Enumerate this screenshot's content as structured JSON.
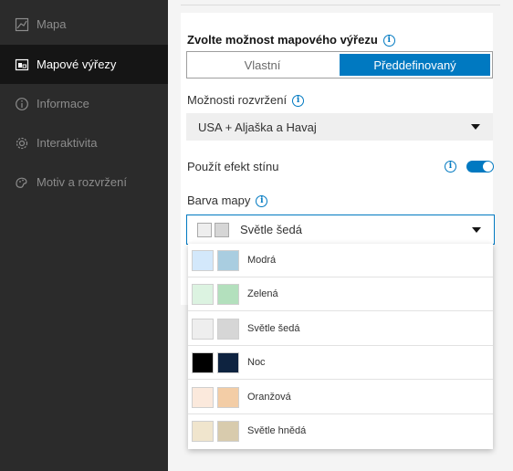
{
  "sidebar": {
    "items": [
      {
        "label": "Mapa",
        "icon": "map-icon"
      },
      {
        "label": "Mapové výřezy",
        "icon": "map-extent-icon"
      },
      {
        "label": "Informace",
        "icon": "info-icon"
      },
      {
        "label": "Interaktivita",
        "icon": "gear-icon"
      },
      {
        "label": "Motiv a rozvržení",
        "icon": "palette-icon"
      }
    ],
    "active_index": 1
  },
  "panel": {
    "heading": "Zvolte možnost mapového výřezu",
    "segments": {
      "custom": "Vlastní",
      "predefined": "Předdefinovaný",
      "selected": "Předdefinovaný"
    },
    "layout_label": "Možnosti rozvržení",
    "layout_value": "USA + Aljaška a Havaj",
    "shadow_label": "Použít efekt stínu",
    "shadow_on": true,
    "color_label": "Barva mapy",
    "color_value": "Světle šedá",
    "color_options": [
      {
        "name": "Modrá",
        "a": "#d3e8fb",
        "b": "#a9cde0"
      },
      {
        "name": "Zelená",
        "a": "#dcf3e1",
        "b": "#b3e0bd"
      },
      {
        "name": "Světle šedá",
        "a": "#eeeeee",
        "b": "#d6d6d6"
      },
      {
        "name": "Noc",
        "a": "#000000",
        "b": "#0e2340"
      },
      {
        "name": "Oranžová",
        "a": "#fbe9dc",
        "b": "#f3cda6"
      },
      {
        "name": "Světle hnědá",
        "a": "#f0e5cd",
        "b": "#d8cbad"
      }
    ]
  },
  "colors": {
    "accent": "#0079c1",
    "sidebar": "#2b2b2b",
    "sidebar_active": "#151515"
  }
}
